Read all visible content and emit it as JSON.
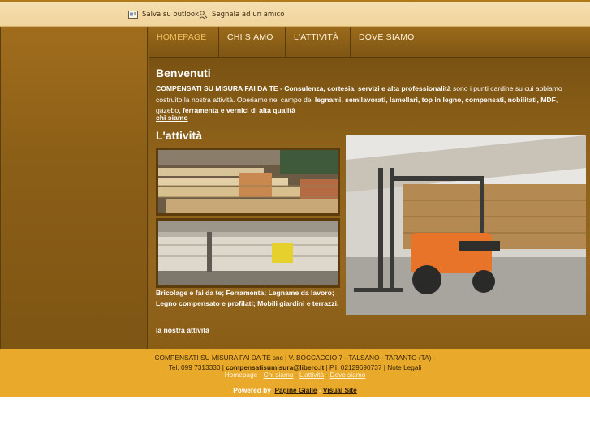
{
  "topbar": {
    "save_label": "Salva su outlook",
    "report_label": "Segnala ad un amico"
  },
  "nav": {
    "items": [
      "HOMEPAGE",
      "CHI SIAMO",
      "L'ATTIVITÀ",
      "DOVE SIAMO"
    ],
    "active": "HOMEPAGE"
  },
  "welcome": {
    "title": "Benvenuti",
    "p1_bold": "COMPENSATI SU MISURA FAI DA TE - Consulenza, cortesia, servizi e alta professionalità",
    "p1_text": " sono i punti cardine su cui abbiamo costruito la nostra attività. Operiamo nel campo dei ",
    "p1_bold2": "legnami, semilavorati, lamellari, top in legno, compensati, nobilitati, MDF",
    "p1_text2": ", gazebo, ",
    "p1_bold3": "ferramenta e vernici di alta qualità",
    "more_link": "chi siamo"
  },
  "activity": {
    "title": "L'attività",
    "caption": "Bricolage e fai da te; Ferramenta; Legname da lavoro; Legno compensato e profilati; Mobili giardini e terrazzi.",
    "link": "la nostra attività"
  },
  "footer": {
    "company_line": "COMPENSATI SU MISURA FAI DA TE snc | V. BOCCACCIO 7 - TALSANO - TARANTO (TA) -",
    "tel": "Tel. 099 7313330",
    "sep1": " | ",
    "email": "compensatisumisura@libero.it",
    "piva": " | P.I. 02129690737 | ",
    "legal": "Note Legali",
    "nav": [
      "Homepage",
      "Chi siamo",
      "L'attività",
      "Dove siamo"
    ],
    "nav_sep": " - ",
    "powered_by": "Powered by",
    "powered_link1": "Pagine Gialle",
    "powered_sep": " - ",
    "powered_link2": "Visual Site"
  },
  "colors": {
    "header_bg": "#f0d49c",
    "main_bg": "#8a5f18",
    "footer_bg": "#e9aa2c",
    "nav_active": "#f0c060"
  }
}
